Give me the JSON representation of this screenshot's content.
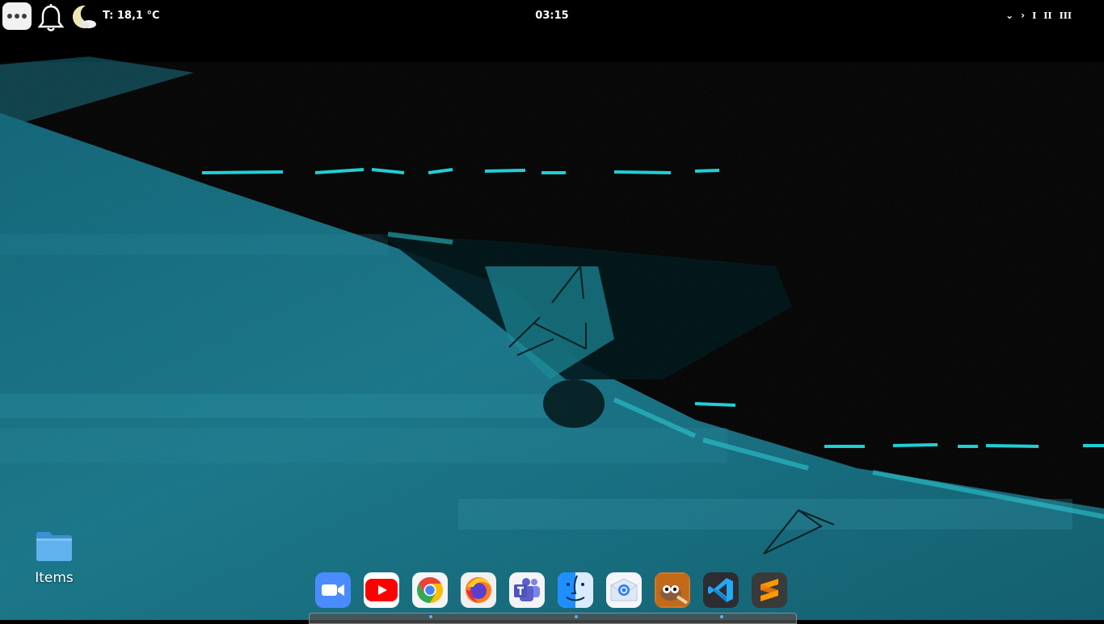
{
  "topbar": {
    "weather": "T: 18,1 °C",
    "clock": "03:15",
    "tray": {
      "arrow_down": "⌄",
      "arrow_right": "›",
      "workspaces": [
        "I",
        "II",
        "III"
      ]
    }
  },
  "desktop": {
    "icons": [
      {
        "label": "Items",
        "icon": "folder-icon"
      }
    ]
  },
  "dock": {
    "apps": [
      {
        "name": "Zoom",
        "icon": "zoom-icon",
        "color": "#4a8cff"
      },
      {
        "name": "YouTube",
        "icon": "youtube-icon",
        "color": "#ff0000"
      },
      {
        "name": "Google Chrome",
        "icon": "chrome-icon",
        "color": "#ffffff"
      },
      {
        "name": "Firefox",
        "icon": "firefox-icon",
        "color": "#ff7b1a"
      },
      {
        "name": "Microsoft Teams",
        "icon": "teams-icon",
        "color": "#5b5fc7"
      },
      {
        "name": "Finder",
        "icon": "finder-icon",
        "color": "#2e9bff"
      },
      {
        "name": "Mail",
        "icon": "mail-icon",
        "color": "#dfe8f5"
      },
      {
        "name": "GIMP",
        "icon": "gimp-icon",
        "color": "#c2691a"
      },
      {
        "name": "Visual Studio Code",
        "icon": "vscode-icon",
        "color": "#23a9f2"
      },
      {
        "name": "Sublime Text",
        "icon": "sublime-icon",
        "color": "#ff9800"
      }
    ]
  },
  "colors": {
    "wallpaper_teal": "#1e7f92",
    "wallpaper_cyan": "#22e5ec",
    "wallpaper_dark": "#000000"
  }
}
